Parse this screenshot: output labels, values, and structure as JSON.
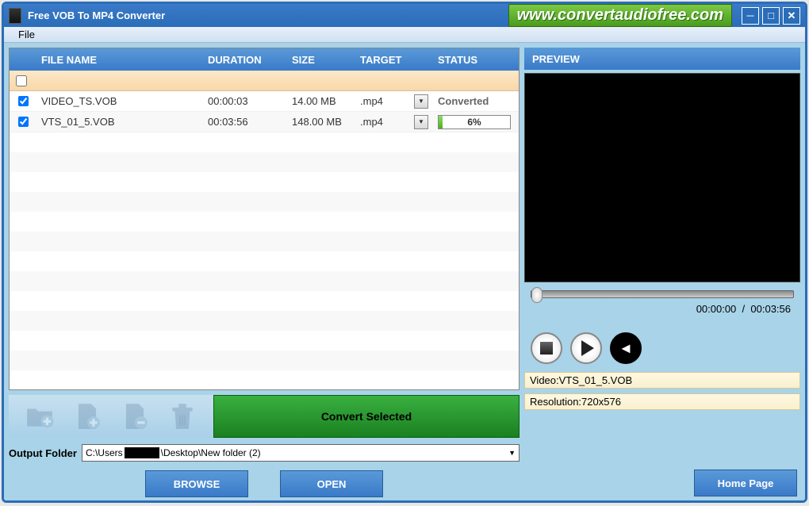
{
  "window": {
    "title": "Free VOB To MP4 Converter",
    "url_banner": "www.convertaudiofree.com"
  },
  "menu": {
    "file": "File"
  },
  "table": {
    "headers": {
      "name": "FILE NAME",
      "duration": "DURATION",
      "size": "SIZE",
      "target": "TARGET",
      "status": "STATUS"
    },
    "rows": [
      {
        "checked": true,
        "name": "VIDEO_TS.VOB",
        "duration": "00:00:03",
        "size": "14.00 MB",
        "target": ".mp4",
        "status_type": "text",
        "status": "Converted"
      },
      {
        "checked": true,
        "name": "VTS_01_5.VOB",
        "duration": "00:03:56",
        "size": "148.00 MB",
        "target": ".mp4",
        "status_type": "progress",
        "progress_pct": 6,
        "progress_text": "6%"
      }
    ]
  },
  "actions": {
    "convert": "Convert Selected",
    "browse": "BROWSE",
    "open": "OPEN",
    "home": "Home Page"
  },
  "output": {
    "label": "Output Folder",
    "path_prefix": "C:\\Users",
    "path_suffix": "\\Desktop\\New folder (2)"
  },
  "preview": {
    "title": "PREVIEW",
    "time_current": "00:00:00",
    "time_sep": "/",
    "time_total": "00:03:56",
    "video_label": "Video:",
    "video_name": "VTS_01_5.VOB",
    "res_label": "Resolution:",
    "res_value": "720x576"
  }
}
